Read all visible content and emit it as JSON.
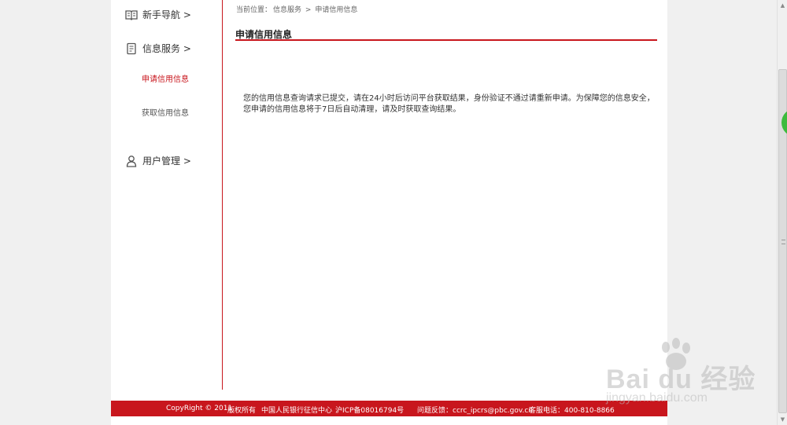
{
  "sidebar": {
    "items": [
      {
        "label": "新手导航 >",
        "icon": "book-icon"
      },
      {
        "label": "信息服务 >",
        "icon": "document-icon"
      },
      {
        "label": "用户管理 >",
        "icon": "user-icon"
      }
    ],
    "sub_items": [
      {
        "label": "申请信用信息",
        "active": true
      },
      {
        "label": "获取信用信息",
        "active": false
      }
    ]
  },
  "breadcrumb": {
    "prefix": "当前位置：",
    "level1": "信息服务",
    "sep": ">",
    "level2": "申请信用信息"
  },
  "content": {
    "title": "申请信用信息",
    "message": "您的信用信息查询请求已提交，请在24小时后访问平台获取结果，身份验证不通过请重新申请。为保障您的信息安全，您申请的信用信息将于7日后自动清理，请及时获取查询结果。"
  },
  "footer": {
    "copyright": "CopyRight © 2011",
    "rights": "版权所有",
    "org": "中国人民银行征信中心",
    "icp": "沪ICP备08016794号",
    "feedback": "问题反馈：ccrc_ipcrs@pbc.gov.cn",
    "hotline": "客服电话：400-810-8866"
  },
  "watermark": {
    "brand": "Bai du 经验",
    "url": "jingyan.baidu.com"
  },
  "colors": {
    "accent": "#c8161d",
    "background": "#f0f0f0"
  }
}
